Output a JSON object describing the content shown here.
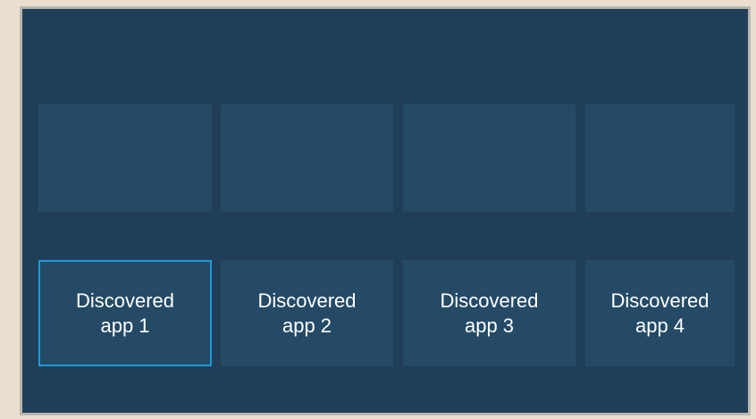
{
  "featured_row": {
    "tiles": [
      {
        "label": ""
      },
      {
        "label": ""
      },
      {
        "label": ""
      },
      {
        "label": ""
      }
    ]
  },
  "apps_row": {
    "tiles": [
      {
        "label": "Discovered app 1",
        "selected": true
      },
      {
        "label": "Discovered app 2",
        "selected": false
      },
      {
        "label": "Discovered app 3",
        "selected": false
      },
      {
        "label": "Discovered app 4",
        "selected": false
      }
    ]
  },
  "colors": {
    "background": "#213e59",
    "tile": "#244a66",
    "focus_border": "#1d9ad6",
    "frame": "#b9b6ad",
    "outer": "#eadfcf"
  }
}
